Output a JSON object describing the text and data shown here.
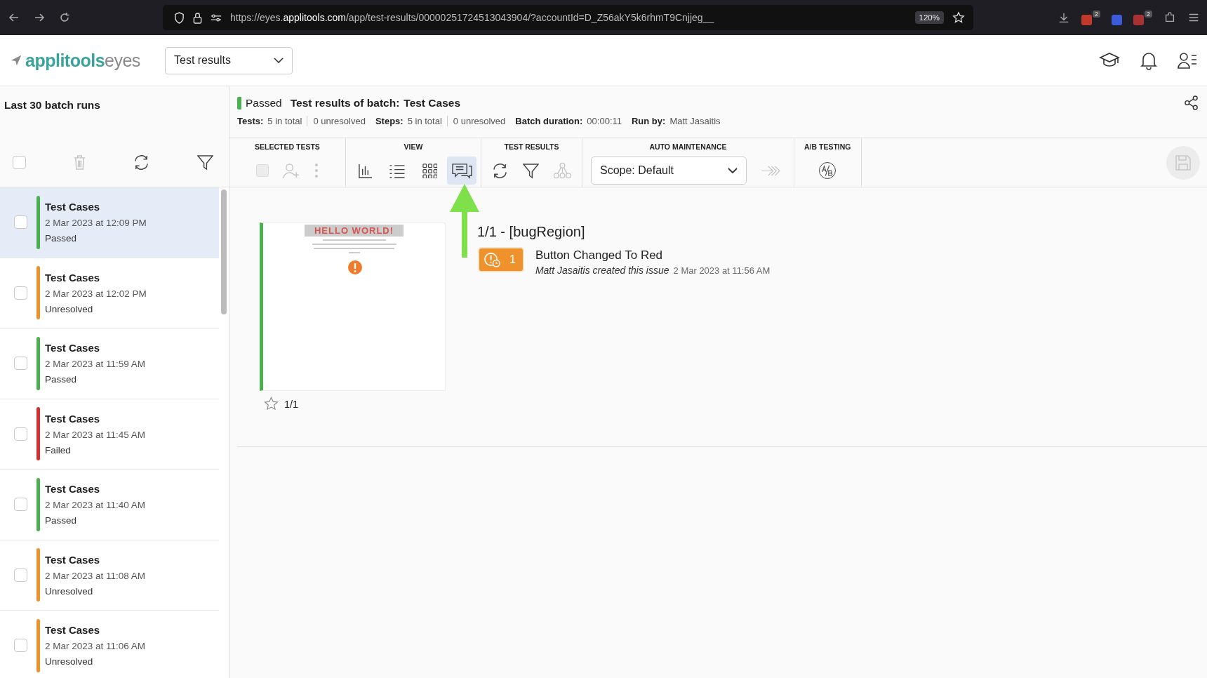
{
  "browser": {
    "url": "https://eyes.**applitools.com**/app/test-results/00000251724513043904/?accountId=D_Z56akY5k6rhmT9Cnjjeg__",
    "zoom": "120%",
    "extension_badges": [
      "2",
      "2"
    ]
  },
  "header": {
    "logo_brand": "applitools",
    "logo_product": "eyes",
    "view_dropdown": "Test results"
  },
  "sidebar": {
    "title": "Last 30 batch runs",
    "select_all_checked": false,
    "items": [
      {
        "name": "Test Cases",
        "date": "2 Mar 2023 at 12:09 PM",
        "status": "Passed",
        "color": "#4caf50",
        "selected": true,
        "checked": false
      },
      {
        "name": "Test Cases",
        "date": "2 Mar 2023 at 12:02 PM",
        "status": "Unresolved",
        "color": "#f0922c",
        "selected": false,
        "checked": false
      },
      {
        "name": "Test Cases",
        "date": "2 Mar 2023 at 11:59 AM",
        "status": "Passed",
        "color": "#4caf50",
        "selected": false,
        "checked": false
      },
      {
        "name": "Test Cases",
        "date": "2 Mar 2023 at 11:45 AM",
        "status": "Failed",
        "color": "#d32f2f",
        "selected": false,
        "checked": false
      },
      {
        "name": "Test Cases",
        "date": "2 Mar 2023 at 11:40 AM",
        "status": "Passed",
        "color": "#4caf50",
        "selected": false,
        "checked": false
      },
      {
        "name": "Test Cases",
        "date": "2 Mar 2023 at 11:08 AM",
        "status": "Unresolved",
        "color": "#f0922c",
        "selected": false,
        "checked": false
      },
      {
        "name": "Test Cases",
        "date": "2 Mar 2023 at 11:06 AM",
        "status": "Unresolved",
        "color": "#f0922c",
        "selected": false,
        "checked": false
      }
    ]
  },
  "batch": {
    "status": "Passed",
    "title_label": "Test results of batch:",
    "title_value": "Test Cases",
    "stats": [
      {
        "label": "Tests:",
        "values": [
          "5 in total",
          "0 unresolved"
        ]
      },
      {
        "label": "Steps:",
        "values": [
          "5 in total",
          "0 unresolved"
        ]
      },
      {
        "label": "Batch duration:",
        "values": [
          "00:00:11"
        ]
      },
      {
        "label": "Run by:",
        "values": [
          "Matt Jasaitis"
        ]
      }
    ]
  },
  "toolbar": [
    {
      "title": "SELECTED TESTS",
      "tools": [
        {
          "kind": "checkbox",
          "disabled": true
        },
        {
          "kind": "assign",
          "disabled": true
        },
        {
          "kind": "more",
          "disabled": true
        }
      ]
    },
    {
      "title": "VIEW",
      "tools": [
        {
          "kind": "chart",
          "selected": false
        },
        {
          "kind": "list",
          "selected": false
        },
        {
          "kind": "grid",
          "selected": false
        },
        {
          "kind": "comments",
          "selected": true
        }
      ]
    },
    {
      "title": "TEST RESULTS",
      "tools": [
        {
          "kind": "refresh",
          "disabled": false
        },
        {
          "kind": "filter",
          "disabled": false
        },
        {
          "kind": "branch",
          "disabled": true
        }
      ]
    },
    {
      "title": "AUTO MAINTENANCE",
      "tools": [
        {
          "kind": "dropdown",
          "value": "Scope: Default"
        },
        {
          "kind": "apply",
          "disabled": true
        }
      ]
    },
    {
      "title": "A/B TESTING",
      "tools": [
        {
          "kind": "ab",
          "disabled": false
        }
      ]
    }
  ],
  "step": {
    "thumbnail_heading": "HELLO WORLD!",
    "starred": false,
    "count": "1/1",
    "title": "1/1 - [bugRegion]",
    "issue": {
      "count": "1",
      "title": "Button Changed To Red",
      "author_line": "Matt Jasaitis created this issue",
      "date": "2 Mar 2023 at 11:56 AM"
    }
  }
}
